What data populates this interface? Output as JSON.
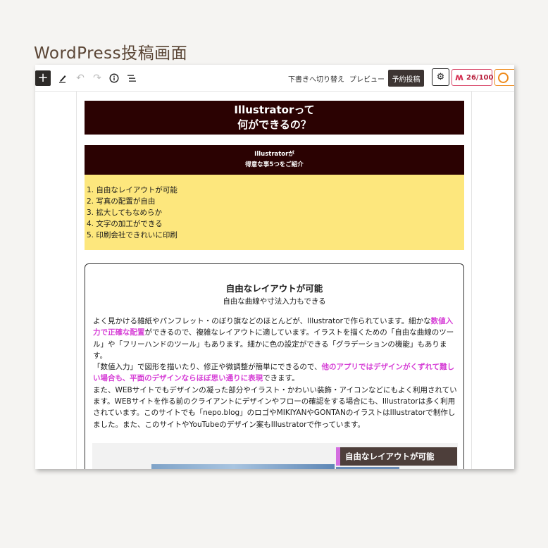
{
  "caption": "WordPress投稿画面",
  "toolbar": {
    "add_icon": "plus-icon",
    "draft_label": "下書きへ切り替え",
    "preview_label": "プレビュー",
    "publish_label": "予約投稿",
    "score_label": "26/100"
  },
  "content": {
    "title_line1": "Illustratorって",
    "title_line2": "何ができるの？",
    "sub_line1": "Illustratorが",
    "sub_line2": "得意な事5つをご紹介",
    "list": [
      "1. 自由なレイアウトが可能",
      "2. 写真の配置が自由",
      "3. 拡大してもなめらか",
      "4. 文字の加工ができる",
      "5. 印刷会社できれいに印刷"
    ],
    "card": {
      "title": "自由なレイアウトが可能",
      "subtitle": "自由な曲線や寸法入力もできる",
      "p1a": "よく見かける雑紙やパンフレット・のぼり旗などのほとんどが、Illustratorで作られています。細かな",
      "p1b": "数値入力で正確な配置",
      "p1c": "ができるので、複雑なレイアウトに適しています。イラストを描くための「自由な曲線のツール」や「フリーハンドのツール」もあります。細かに色の設定ができる「グラデーションの機能」もあります。",
      "p2a": "「数値入力」で図形を描いたり、修正や微調整が簡単にできるので、",
      "p2b": "他のアプリではデザインがくずれて難しい場合も、平面のデザインならほぼ思い通りに表現",
      "p2c": "できます。",
      "p3": "また、WEBサイトでもデザインの凝った部分やイラスト・かわいい装飾・アイコンなどにもよく利用されています。WEBサイトを作る前のクライアントにデザインやフローの確認をする場合にも、Illustratorは多く利用されています。このサイトでも「nepo.blog」のロゴやMIKIYANやGONTANのイラストはIllustratorで制作しました。また、このサイトやYouTubeのデザイン案もIllustratorで作っています。",
      "preview_label": "自由なレイアウトが可能"
    }
  }
}
